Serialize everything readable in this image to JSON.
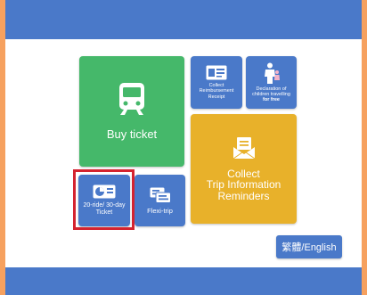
{
  "tiles": {
    "buy_ticket": {
      "label": "Buy ticket",
      "icon": "train-icon",
      "color": "#45b86a"
    },
    "collect_receipt": {
      "label_line1": "Collect",
      "label_line2": "Reimbursement",
      "label_line3": "Receipt",
      "icon": "receipt-icon",
      "color": "#4a79c9"
    },
    "child_declaration": {
      "label_line1": "Declaration of",
      "label_line2": "children travelling",
      "label_line3": "for free",
      "icon": "family-icon",
      "color": "#4a79c9"
    },
    "collect_trip": {
      "label_line1": "Collect",
      "label_line2": "Trip Information",
      "label_line3": "Reminders",
      "icon": "envelope-icon",
      "color": "#e8b12a"
    },
    "ride_20": {
      "label_line1": "20-ride/ 30-day",
      "label_line2": "Ticket",
      "icon": "ticket-card-icon",
      "color": "#4a79c9",
      "selected": true
    },
    "flexi_trip": {
      "label": "Flexi-trip",
      "icon": "flexi-ticket-icon",
      "color": "#4a79c9"
    }
  },
  "language_button": {
    "label": "繁體/English"
  },
  "colors": {
    "frame": "#f6a15f",
    "bar": "#4a79c9",
    "highlight": "#d4232f"
  }
}
